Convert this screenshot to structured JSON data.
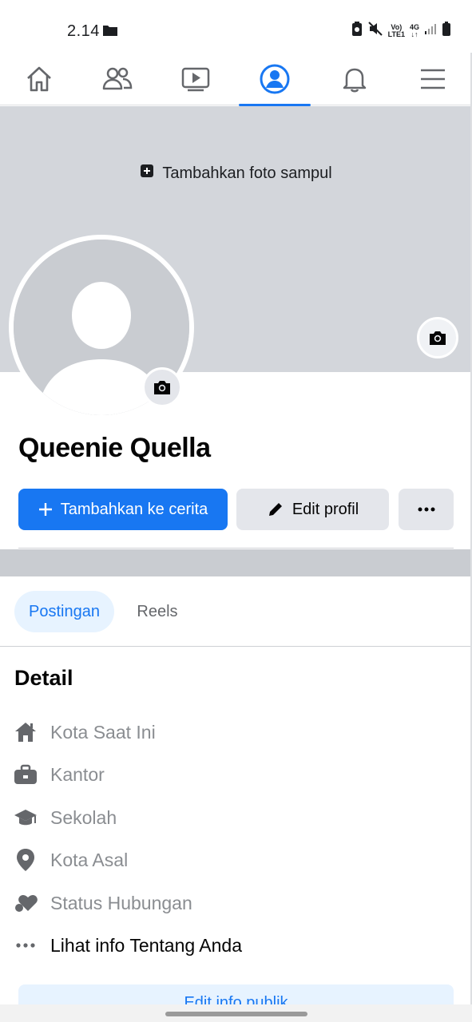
{
  "status_bar": {
    "time": "2.14",
    "network_top": "Vo)",
    "network_bottom": "LTE1",
    "data_top": "4G",
    "data_bottom": "↓↑"
  },
  "nav": {
    "items": [
      {
        "name": "home-tab",
        "icon": "home-icon"
      },
      {
        "name": "friends-tab",
        "icon": "friends-icon"
      },
      {
        "name": "video-tab",
        "icon": "video-icon"
      },
      {
        "name": "profile-tab",
        "icon": "profile-icon",
        "active": true
      },
      {
        "name": "notifications-tab",
        "icon": "bell-icon"
      },
      {
        "name": "menu-tab",
        "icon": "menu-icon"
      }
    ],
    "accent_color": "#1877f2"
  },
  "cover": {
    "add_photo_label": "Tambahkan foto sampul"
  },
  "profile": {
    "name": "Queenie Quella"
  },
  "actions": {
    "add_story_label": "Tambahkan ke cerita",
    "edit_profile_label": "Edit profil",
    "more_label": "···"
  },
  "tabs": {
    "posts_label": "Postingan",
    "reels_label": "Reels"
  },
  "details": {
    "title": "Detail",
    "items": [
      {
        "label": "Kota Saat Ini",
        "icon": "house-icon"
      },
      {
        "label": "Kantor",
        "icon": "briefcase-icon"
      },
      {
        "label": "Sekolah",
        "icon": "graduation-cap-icon"
      },
      {
        "label": "Kota Asal",
        "icon": "location-pin-icon"
      },
      {
        "label": "Status Hubungan",
        "icon": "heart-icon"
      },
      {
        "label": "Lihat info Tentang Anda",
        "icon": "more-dots-icon"
      }
    ],
    "edit_public_label": "Edit info publik"
  }
}
